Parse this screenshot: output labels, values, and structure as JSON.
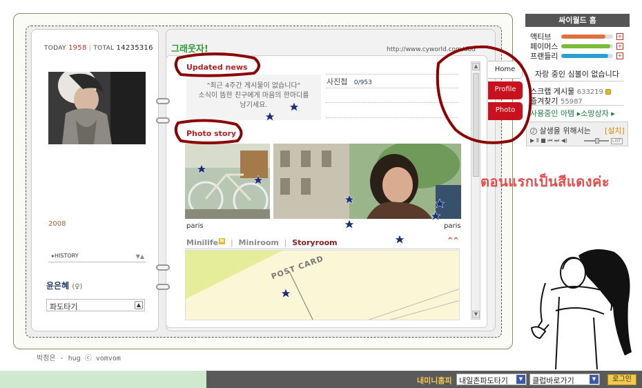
{
  "header": {
    "today_label": "TODAY",
    "today_count": "1958",
    "total_label": "TOTAL",
    "total_count": "14235316",
    "minihome_title": "그래웃자!",
    "url": "http://www.cyworld.com/dbd"
  },
  "profile": {
    "year": "2008",
    "history_label": "HISTORY",
    "history_arrows": "▼▲",
    "name": "윤은혜",
    "sex_symbol": "(♀)",
    "select_value": "파도타기"
  },
  "updated_news": {
    "label": "Updated news",
    "empty_line1": "\"최근 4주간 게시물이 없습니다\"",
    "empty_line2": "소식이 뜸한 친구에게 마음의 한마디를",
    "empty_line3": "남기세요.",
    "photobook_label": "사진첩",
    "photobook_count": "0/953"
  },
  "photo_story": {
    "label": "Photo story",
    "caption1": "paris",
    "caption2": "paris"
  },
  "room_tabs": {
    "minilife": "Minilife",
    "minilife_badge": "N",
    "miniroom": "Miniroom",
    "storyroom": "Storyroom",
    "separator": "|",
    "collapse": "^^",
    "postcard_text": "POST CARD"
  },
  "scrollbar": {
    "up": "▲",
    "down": "▼"
  },
  "side_tabs": {
    "home": "Home",
    "profile": "Profile",
    "photo": "Photo"
  },
  "widget": {
    "title": "싸이월드 홈",
    "stats": [
      {
        "label": "액티브",
        "level": 0.85,
        "color": "#e07040",
        "plus": "+"
      },
      {
        "label": "페이머스",
        "level": 0.95,
        "color": "#7cba3c",
        "plus": "+"
      },
      {
        "label": "프랜들리",
        "level": 0.9,
        "color": "#2aa0d0",
        "plus": "+"
      }
    ],
    "status_text": "자랑 중인 심볼이 없습니다",
    "scrap_label": "스크랩 게시물",
    "scrap_count": "633219",
    "fav_label": "즐겨찾기",
    "fav_count": "55987",
    "usage_text": "사용중인 아템 ▸소망상자 ▸",
    "bgm_title": "살생을 위해서는",
    "bgm_install": "[설치]",
    "bgm_controls": "▶ Ⅱ ■ ⏮ ⏭ ◀)",
    "bgm_list": "LIST"
  },
  "annotation_note": "ตอนแรกเป็นสีแดงค่ะ",
  "credit": "박정은 - hug ⓒ vomvom",
  "bottom_bar": {
    "minihome_link": "내미니홈피",
    "dropdown1": "내일촌파도타기",
    "dropdown2": "클럽바로가기",
    "login": "로그인"
  },
  "colors": {
    "highlight_red": "#8b0000",
    "tab_red": "#c8101e",
    "title_green": "#2e9a3a"
  }
}
